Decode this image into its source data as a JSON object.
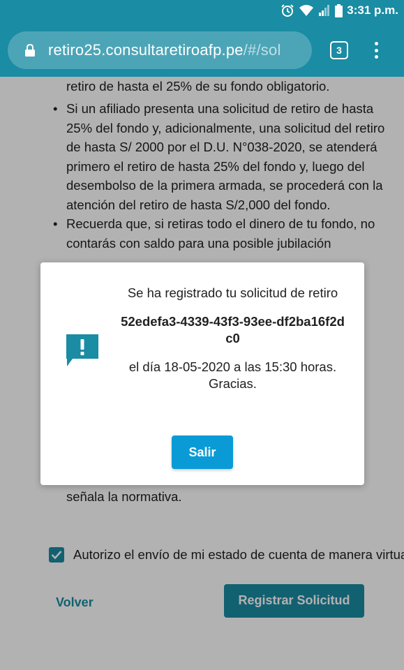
{
  "status_bar": {
    "time": "3:31 p.m.",
    "icons": [
      "alarm-icon",
      "wifi-icon",
      "signal-icon",
      "battery-icon"
    ]
  },
  "browser": {
    "url_main": "retiro25.consultaretiroafp.pe",
    "url_rest": "/#/sol",
    "tab_count": "3",
    "theme_color": "#1a8ca3"
  },
  "page": {
    "fragment_top": "retiro de hasta el 25% de su fondo obligatorio.",
    "bullets": [
      "Si un afiliado presenta una solicitud de retiro de hasta 25% del fondo y, adicionalmente, una solicitud del retiro de hasta S/ 2000 por el D.U. N°038-2020, se atenderá primero el retiro de hasta 25% del fondo y, luego del desembolso de la primera armada, se procederá con la atención del retiro de hasta S/2,000 del fondo.",
      "Recuerda que, si retiras todo el dinero de tu fondo, no contarás con saldo para una posible jubilación"
    ],
    "fragment_bottom": "señala la normativa.",
    "consent_label": "Autorizo el envío de mi estado de cuenta de manera virtual",
    "consent_checked": true,
    "back_label": "Volver",
    "submit_label": "Registrar Solicitud"
  },
  "modal": {
    "icon": "alert-message-icon",
    "title": "Se ha registrado tu solicitud de retiro",
    "code": "52edefa3-4339-43f3-93ee-df2ba16f2dc0",
    "date_text": "el día 18-05-2020 a las 15:30 horas. Gracias.",
    "exit_label": "Salir",
    "button_color": "#0a9bd6"
  }
}
